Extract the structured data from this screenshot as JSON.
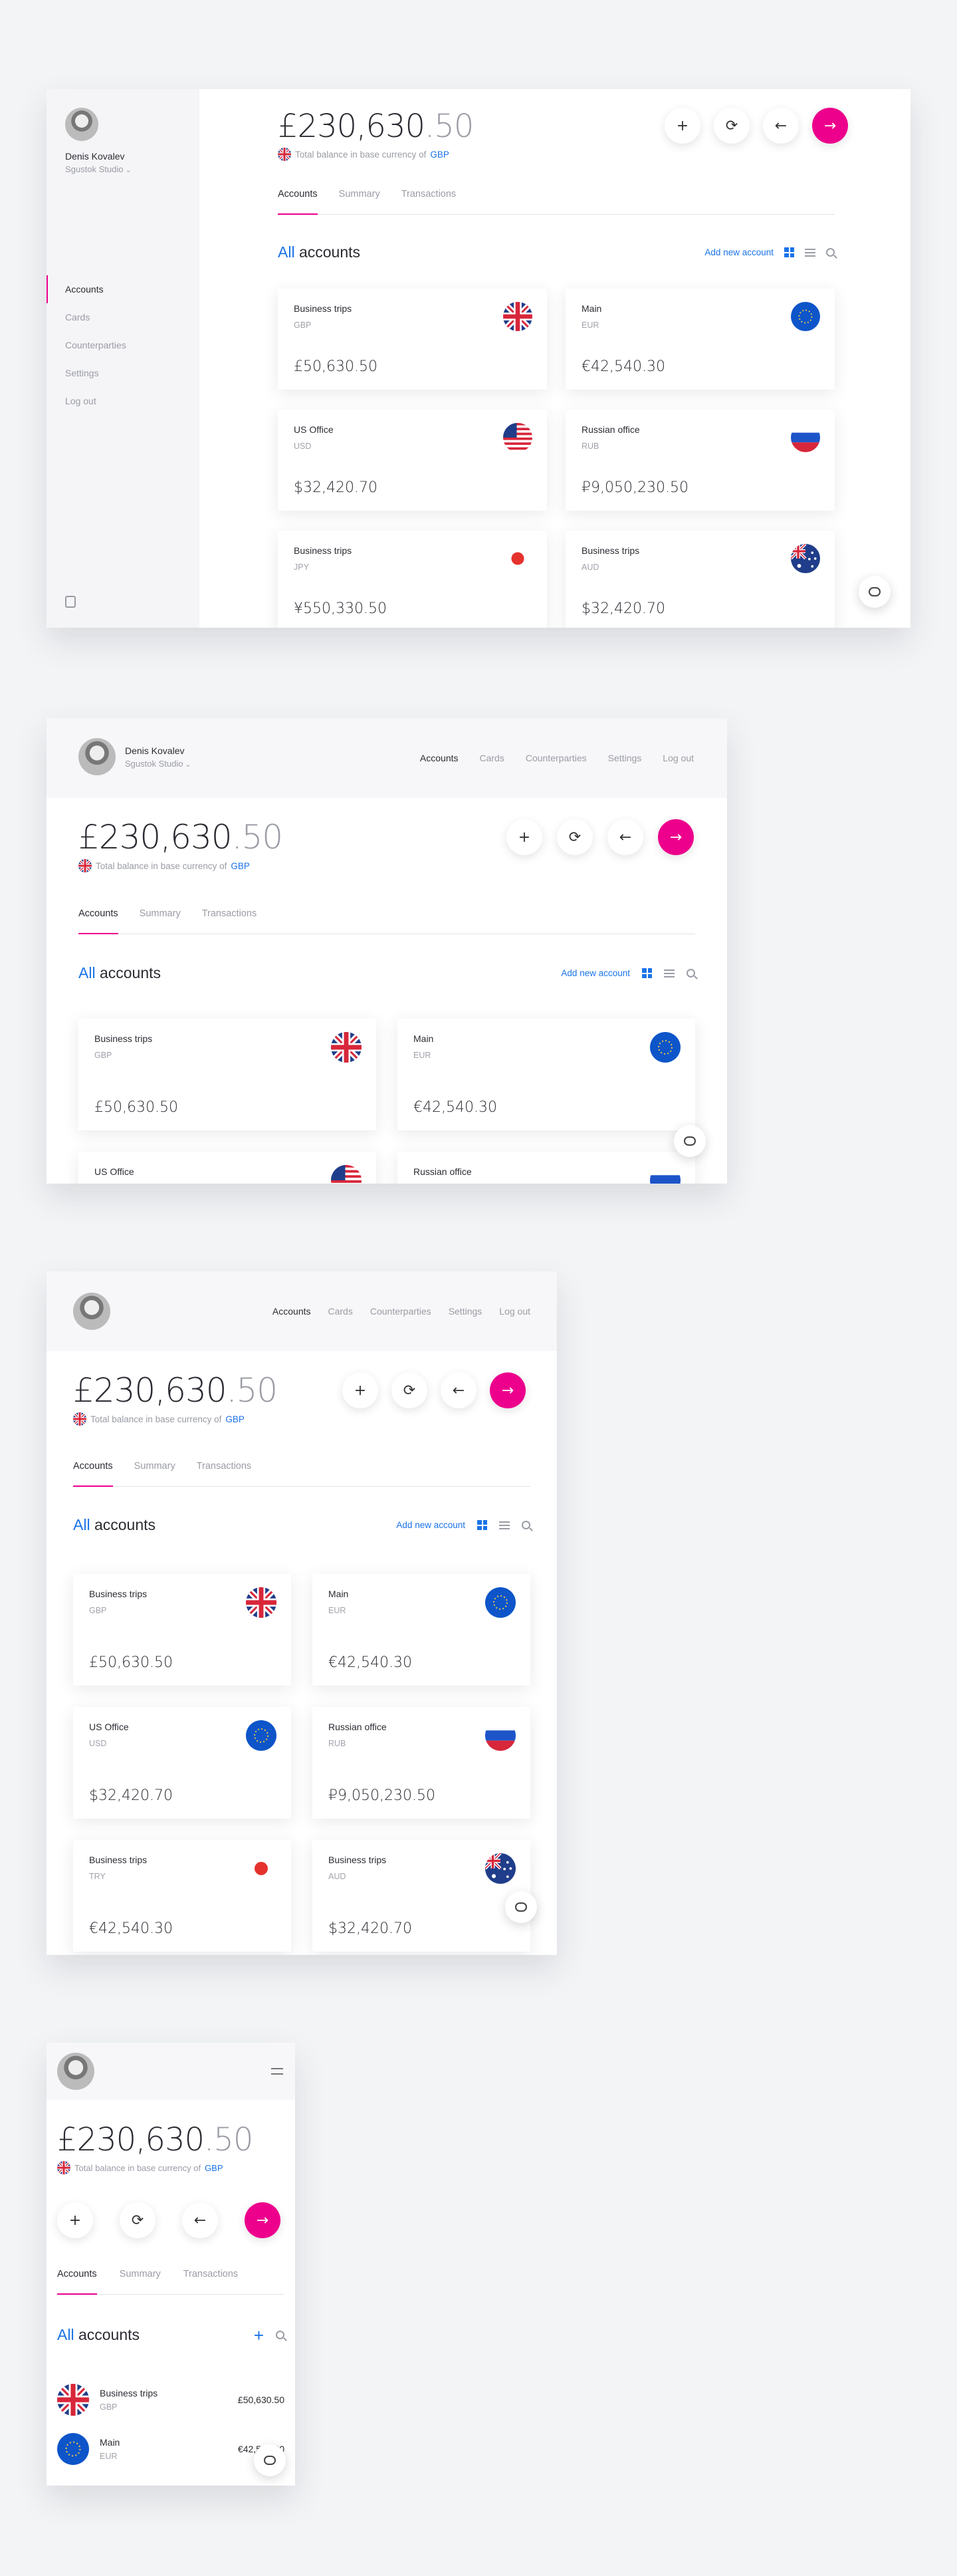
{
  "user": {
    "name": "Denis Kovalev",
    "org": "Sgustok Studio"
  },
  "nav": [
    "Accounts",
    "Cards",
    "Counterparties",
    "Settings",
    "Log out"
  ],
  "balance": {
    "main": "£230,630",
    "decimals": ".50",
    "subtitle": "Total balance in base currency of",
    "currency": "GBP"
  },
  "actions": {
    "add": "+",
    "refresh": "⟳",
    "back": "←",
    "send": "→"
  },
  "tabs": [
    "Accounts",
    "Summary",
    "Transactions"
  ],
  "section": {
    "all": "All",
    "title": "accounts",
    "add_link": "Add new account"
  },
  "accounts_desktop": [
    {
      "name": "Business trips",
      "currency": "GBP",
      "amount": "£50,630.50",
      "flag": "uk"
    },
    {
      "name": "Main",
      "currency": "EUR",
      "amount": "€42,540.30",
      "flag": "eu"
    },
    {
      "name": "US Office",
      "currency": "USD",
      "amount": "$32,420.70",
      "flag": "us"
    },
    {
      "name": "Russian office",
      "currency": "RUB",
      "amount": "₽9,050,230.50",
      "flag": "ru"
    },
    {
      "name": "Business trips",
      "currency": "JPY",
      "amount": "¥550,330.50",
      "flag": "jp"
    },
    {
      "name": "Business trips",
      "currency": "AUD",
      "amount": "$32,420.70",
      "flag": "au"
    }
  ],
  "accounts_tablet": [
    {
      "name": "Business trips",
      "currency": "GBP",
      "amount": "£50,630.50",
      "flag": "uk"
    },
    {
      "name": "Main",
      "currency": "EUR",
      "amount": "€42,540.30",
      "flag": "eu"
    },
    {
      "name": "US Office",
      "currency": "USD",
      "amount": "$32,420.70",
      "flag": "eu"
    },
    {
      "name": "Russian office",
      "currency": "RUB",
      "amount": "₽9,050,230.50",
      "flag": "ru"
    },
    {
      "name": "Business trips",
      "currency": "TRY",
      "amount": "€42,540.30",
      "flag": "jp"
    },
    {
      "name": "Business trips",
      "currency": "AUD",
      "amount": "$32,420.70",
      "flag": "au"
    }
  ],
  "accounts_mobile": [
    {
      "name": "Business trips",
      "currency": "GBP",
      "amount": "£50,630.50",
      "flag": "uk"
    },
    {
      "name": "Main",
      "currency": "EUR",
      "amount": "€42,540.30",
      "flag": "eu"
    }
  ],
  "colors": {
    "accent": "#ec008c",
    "link": "#1a73e8",
    "muted": "#9a9ca5",
    "text": "#2b2b33",
    "background": "#f3f4f6"
  }
}
